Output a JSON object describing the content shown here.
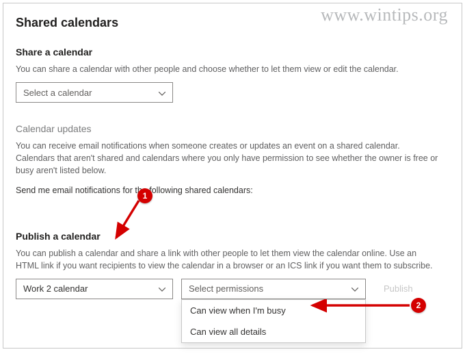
{
  "watermark": "www.wintips.org",
  "page_title": "Shared calendars",
  "share": {
    "title": "Share a calendar",
    "desc": "You can share a calendar with other people and choose whether to let them view or edit the calendar.",
    "select_placeholder": "Select a calendar"
  },
  "updates": {
    "title": "Calendar updates",
    "desc": "You can receive email notifications when someone creates or updates an event on a shared calendar. Calendars that aren't shared and calendars where you only have permission to see whether the owner is free or busy aren't listed below.",
    "instruction": "Send me email notifications for the following shared calendars:"
  },
  "publish": {
    "title": "Publish a calendar",
    "desc": "You can publish a calendar and share a link with other people to let them view the calendar online. Use an HTML link if you want recipients to view the calendar in a browser or an ICS link if you want them to subscribe.",
    "calendar_value": "Work 2 calendar",
    "perm_placeholder": "Select permissions",
    "button": "Publish",
    "options": [
      "Can view when I'm busy",
      "Can view all details"
    ]
  },
  "annotations": {
    "first": "1",
    "second": "2"
  }
}
